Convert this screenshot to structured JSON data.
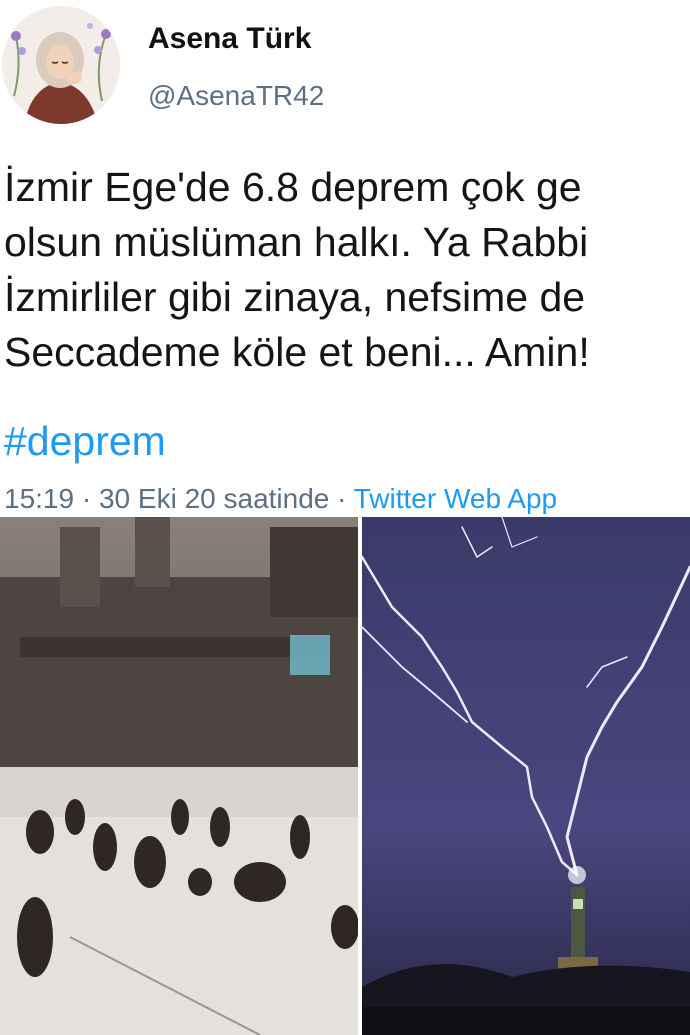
{
  "tweet": {
    "author": {
      "display_name": "Asena Türk",
      "handle": "@AsenaTR42",
      "avatar_icon": "cartoon-woman-hijab-avatar"
    },
    "text_lines": [
      "İzmir Ege'de 6.8  deprem çok ge",
      "olsun müslüman halkı. Ya Rabbi",
      "İzmirliler gibi zinaya, nefsime de",
      "Seccademe köle et beni... Amin!"
    ],
    "hashtag": "#deprem",
    "meta": {
      "time": "15:19",
      "separator": " · ",
      "date": "30 Eki 20 saatinde",
      "source": "Twitter Web App"
    },
    "media": [
      {
        "name": "storm-crowd-photo",
        "description_icon": "mosque-courtyard-storm"
      },
      {
        "name": "lightning-tower-photo",
        "description_icon": "lightning-clock-tower"
      }
    ],
    "colors": {
      "link": "#1d9bf0",
      "secondary_text": "#5b7083",
      "primary_text": "#151515"
    }
  }
}
